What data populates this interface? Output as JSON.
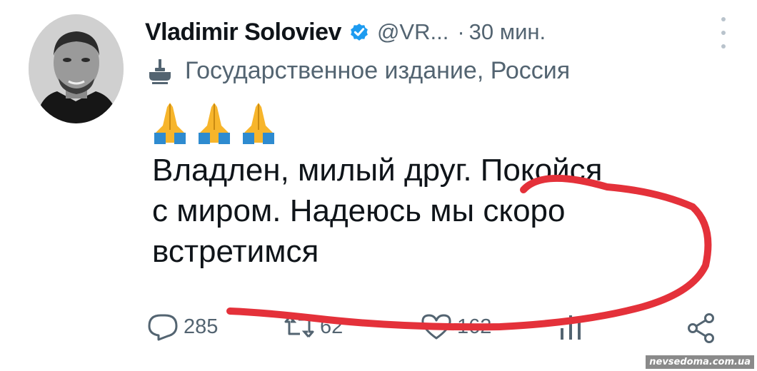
{
  "tweet": {
    "author": {
      "display_name": "Vladimir Soloviev",
      "handle": "@VR...",
      "separator": "·",
      "time": "30 мин.",
      "verified": true,
      "verified_color": "#1d9bf0"
    },
    "label": {
      "icon": "government-building-icon",
      "text": "Государственное издание, Россия"
    },
    "emoji": [
      "🙏",
      "🙏",
      "🙏"
    ],
    "text_lines": [
      "Владлен, милый друг. Покойся",
      "с миром. Надеюсь мы скоро",
      "встретимся"
    ],
    "actions": {
      "reply": {
        "icon": "reply-icon",
        "count": "285"
      },
      "retweet": {
        "icon": "retweet-icon",
        "count": "62"
      },
      "like": {
        "icon": "heart-icon",
        "count": "162"
      },
      "views": {
        "icon": "views-icon"
      },
      "share": {
        "icon": "share-icon"
      }
    }
  },
  "annotation": {
    "color": "#e4313a"
  },
  "watermark": "nevsedoma.com.ua"
}
